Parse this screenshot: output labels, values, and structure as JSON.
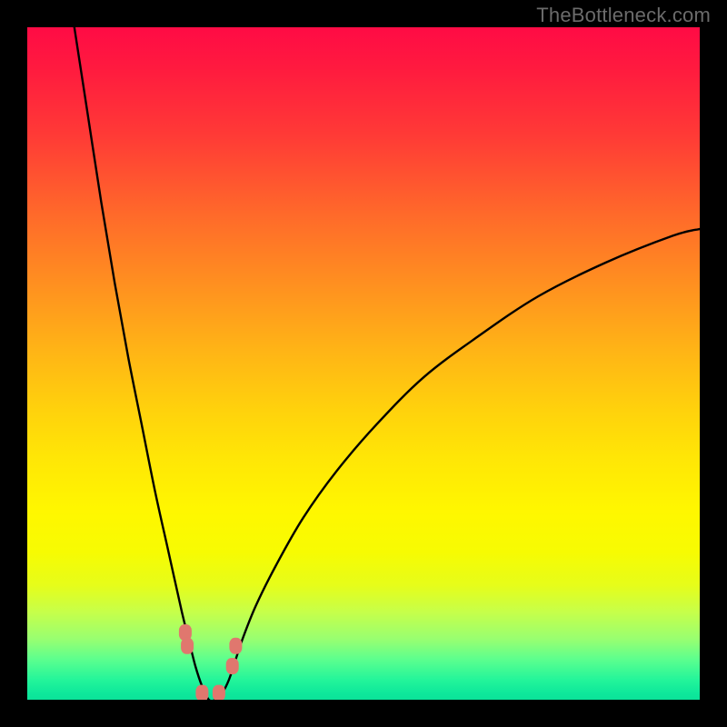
{
  "watermark": "TheBottleneck.com",
  "colors": {
    "frame": "#000000",
    "curve": "#000000",
    "marker": "#e0776e",
    "gradient_stops": [
      "#ff0b45",
      "#ff1a3f",
      "#ff3a36",
      "#ff6a2a",
      "#ff8f20",
      "#ffb416",
      "#ffd20c",
      "#ffe606",
      "#fff700",
      "#f7fb02",
      "#e6fd1a",
      "#c6ff4a",
      "#98ff71",
      "#5cff8e",
      "#24f59a",
      "#0ee89b",
      "#0be299"
    ]
  },
  "chart_data": {
    "type": "line",
    "title": "",
    "xlabel": "",
    "ylabel": "",
    "xlim": [
      0,
      100
    ],
    "ylim": [
      0,
      100
    ],
    "grid": false,
    "curve_description": "V-shaped bottleneck curve: steep drop to ~0 near x≈27, then slow asymptotic rise toward ~70",
    "x": [
      7,
      9,
      11,
      13,
      15,
      17,
      19,
      21,
      23,
      24,
      25,
      26,
      27,
      28,
      29,
      30,
      31,
      32,
      34,
      37,
      41,
      46,
      52,
      59,
      67,
      76,
      86,
      96,
      100
    ],
    "y": [
      100,
      87,
      74,
      62,
      51,
      41,
      31,
      22,
      13,
      9,
      5,
      2,
      0,
      0,
      1,
      3,
      6,
      9,
      14,
      20,
      27,
      34,
      41,
      48,
      54,
      60,
      65,
      69,
      70
    ],
    "markers": {
      "description": "highlighted points near the minimum",
      "points": [
        {
          "x": 23.5,
          "y": 10
        },
        {
          "x": 23.8,
          "y": 8
        },
        {
          "x": 26.0,
          "y": 1
        },
        {
          "x": 28.5,
          "y": 1
        },
        {
          "x": 30.5,
          "y": 5
        },
        {
          "x": 31.0,
          "y": 8
        }
      ]
    }
  }
}
